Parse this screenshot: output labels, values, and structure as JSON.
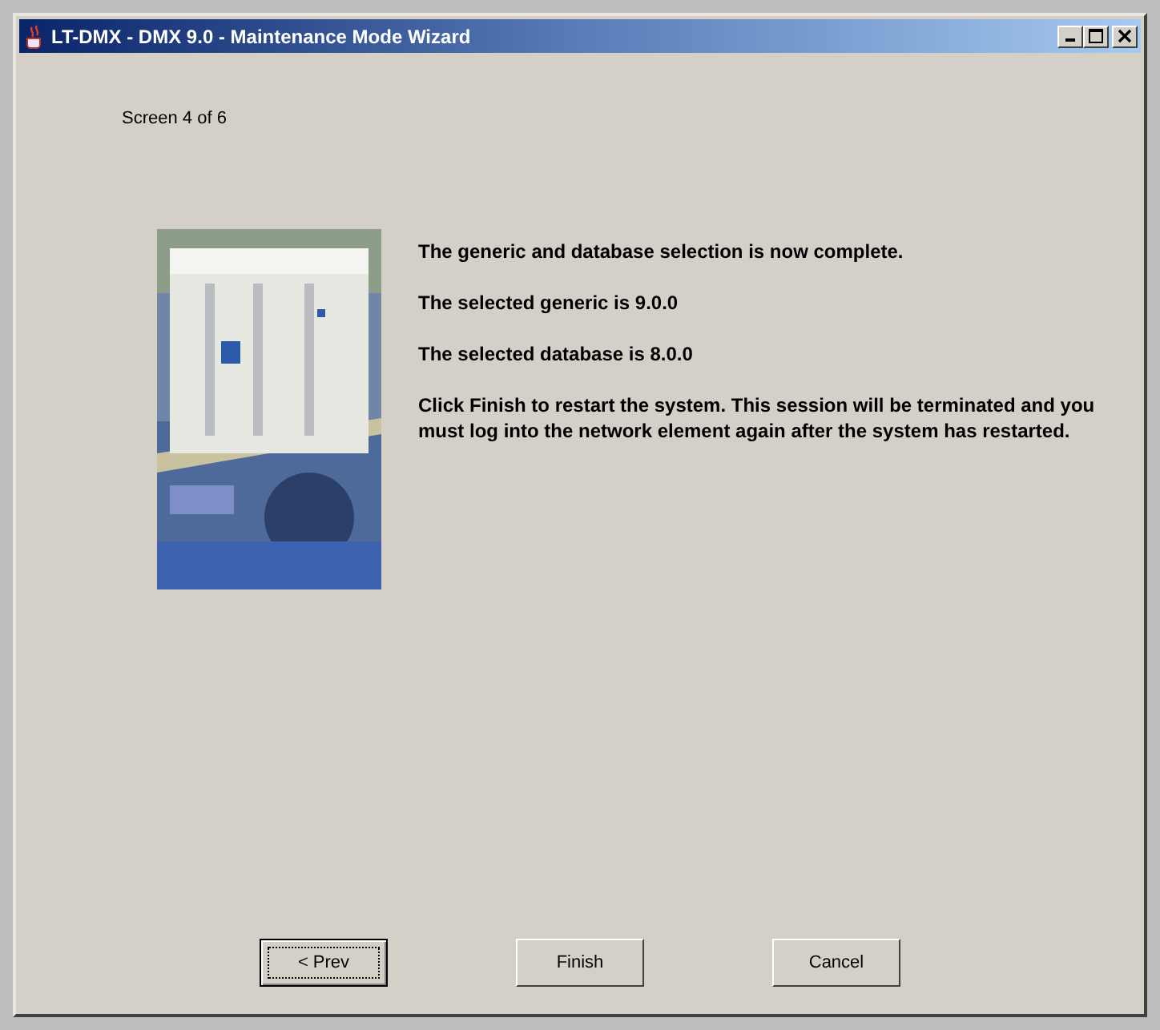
{
  "window": {
    "title": "LT-DMX - DMX 9.0 - Maintenance Mode Wizard"
  },
  "step": "Screen 4 of 6",
  "paragraphs": [
    "The generic and database selection is now complete.",
    "The selected generic is 9.0.0",
    "The selected database is 8.0.0",
    "Click Finish to restart the system. This session will be terminated and you must log into the network element again after the system has restarted."
  ],
  "buttons": [
    {
      "label": "< Prev",
      "focused": true
    },
    {
      "label": "Finish",
      "focused": false
    },
    {
      "label": "Cancel",
      "focused": false
    }
  ]
}
